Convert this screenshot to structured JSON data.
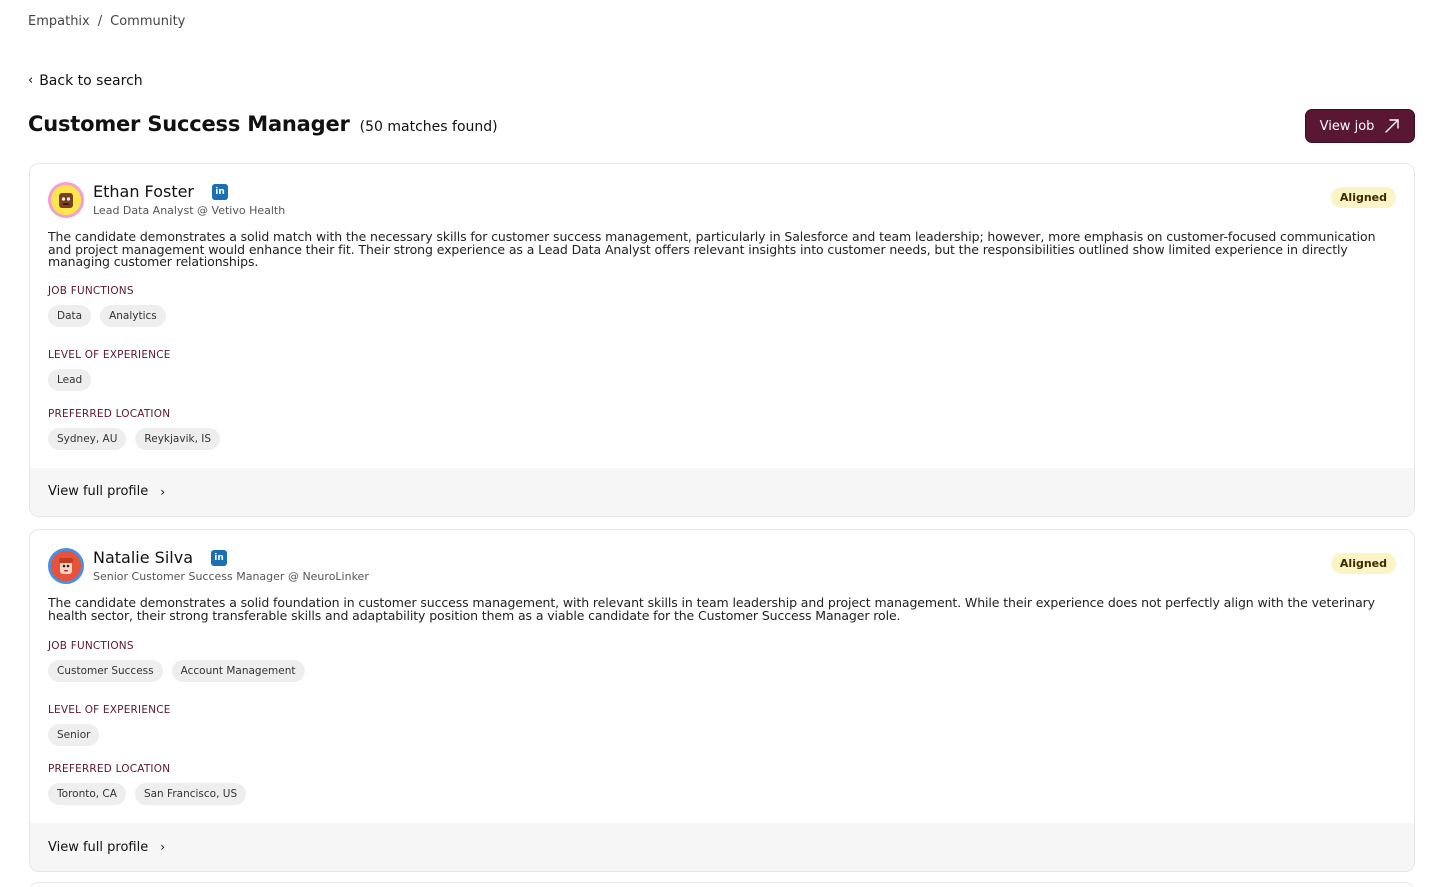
{
  "breadcrumb": [
    "Empathix",
    "Community"
  ],
  "breadcrumb_sep": "/",
  "back_label": "Back to search",
  "page_title": "Customer Success Manager",
  "matches_text": "(50 matches found)",
  "view_job_label": "View job",
  "linkedin_label": "in",
  "labels": {
    "job_functions": "JOB FUNCTIONS",
    "level": "LEVEL OF EXPERIENCE",
    "location": "PREFERRED LOCATION",
    "view_full_profile": "View full profile"
  },
  "candidates": [
    {
      "name": "Ethan Foster",
      "role": "Lead Data Analyst @ Vetivo Health",
      "badge": "Aligned",
      "summary": "The candidate demonstrates a solid match with the necessary skills for customer success management, particularly in Salesforce and team leadership; however, more emphasis on customer-focused communication and project management would enhance their fit. Their strong experience as a Lead Data Analyst offers relevant insights into customer needs, but the responsibilities outlined show limited experience in directly managing customer relationships.",
      "job_functions": [
        "Data",
        "Analytics"
      ],
      "level": [
        "Lead"
      ],
      "locations": [
        "Sydney, AU",
        "Reykjavik, IS"
      ]
    },
    {
      "name": "Natalie Silva",
      "role": "Senior Customer Success Manager @ NeuroLinker",
      "badge": "Aligned",
      "summary": "The candidate demonstrates a solid foundation in customer success management, with relevant skills in team leadership and project management. While their experience does not perfectly align with the veterinary health sector, their strong transferable skills and adaptability position them as a viable candidate for the Customer Success Manager role.",
      "job_functions": [
        "Customer Success",
        "Account Management"
      ],
      "level": [
        "Senior"
      ],
      "locations": [
        "Toronto, CA",
        "San Francisco, US"
      ]
    }
  ],
  "colors": {
    "brand": "#5a1734",
    "badge_bg": "#fbf4c5",
    "linkedin": "#1a6fb5"
  },
  "icons": {
    "back": "chevron-left-icon",
    "view_job": "arrow-up-right-icon",
    "linkedin": "linkedin-icon",
    "view_profile": "chevron-right-icon"
  }
}
